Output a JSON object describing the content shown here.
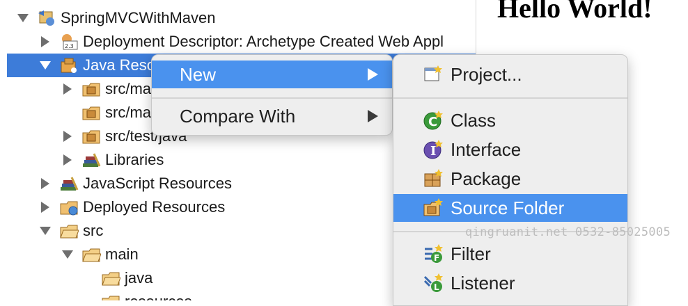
{
  "tree": {
    "items": [
      {
        "label": "SpringMVCWithMaven"
      },
      {
        "label": "Deployment Descriptor: Archetype Created Web Appl"
      },
      {
        "label": "Java Reso"
      },
      {
        "label": "src/ma"
      },
      {
        "label": "src/ma"
      },
      {
        "label": "src/test/java"
      },
      {
        "label": "Libraries"
      },
      {
        "label": "JavaScript Resources"
      },
      {
        "label": "Deployed Resources"
      },
      {
        "label": "src"
      },
      {
        "label": "main"
      },
      {
        "label": "java"
      },
      {
        "label": "resources"
      }
    ]
  },
  "preview": {
    "heading": "Hello World!"
  },
  "context_menu": {
    "items": [
      {
        "label": "New"
      },
      {
        "label": "Compare With"
      }
    ]
  },
  "submenu": {
    "items": [
      {
        "label": "Project...",
        "icon": "project-icon"
      },
      {
        "label": "Class",
        "icon": "class-icon"
      },
      {
        "label": "Interface",
        "icon": "interface-icon"
      },
      {
        "label": "Package",
        "icon": "package-icon"
      },
      {
        "label": "Source Folder",
        "icon": "source-folder-icon"
      },
      {
        "label": "Filter",
        "icon": "filter-icon"
      },
      {
        "label": "Listener",
        "icon": "listener-icon"
      }
    ]
  },
  "watermark": "qingruanit.net 0532-85025005",
  "colors": {
    "selection": "#3d7cd9",
    "menu_highlight": "#4a92ee"
  }
}
